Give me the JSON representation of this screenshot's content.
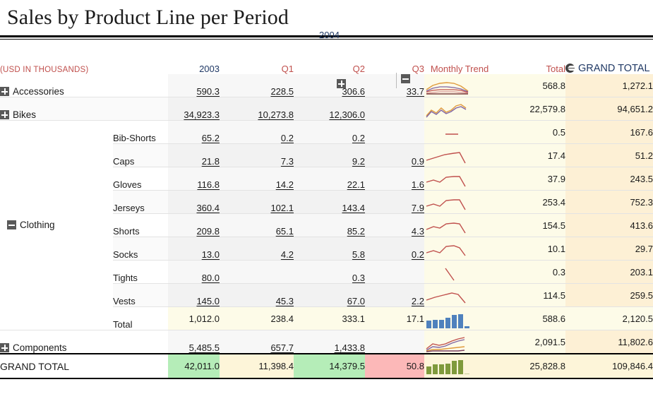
{
  "report": {
    "title": "Sales by Product Line per Period",
    "units_note": "(USD IN THOUSANDS)"
  },
  "header": {
    "year_2003": "2003",
    "year_2004": "2004",
    "q1": "Q1",
    "q2": "Q2",
    "q3": "Q3",
    "monthly_trend": "Monthly Trend",
    "total": "Total",
    "grand_total": "GRAND TOTAL",
    "toggle_2003": "expand-2003",
    "toggle_2004": "collapse-2004",
    "grand_total_icon": "sort-toggle-icon"
  },
  "columns": [
    "2003",
    "Q1",
    "Q2",
    "Q3",
    "Monthly Trend",
    "Total",
    "GRAND TOTAL"
  ],
  "rows": [
    {
      "label": "Accessories",
      "toggle": "plus",
      "level": "category",
      "y2003": "590.3",
      "q1": "228.5",
      "q2": "306.6",
      "q3": "33.7",
      "total": "568.8",
      "grand": "1,272.1",
      "spark": "multi-flat"
    },
    {
      "label": "Bikes",
      "toggle": "plus",
      "level": "category",
      "y2003": "34,923.3",
      "q1": "10,273.8",
      "q2": "12,306.0",
      "q3": "",
      "total": "22,579.8",
      "grand": "94,651.2",
      "spark": "multi-zigzag"
    },
    {
      "label": "Bib-Shorts",
      "level": "sub",
      "y2003": "65.2",
      "q1": "0.2",
      "q2": "0.2",
      "q3": "",
      "total": "0.5",
      "grand": "167.6",
      "spark": "stub"
    },
    {
      "label": "Caps",
      "level": "sub",
      "y2003": "21.8",
      "q1": "7.3",
      "q2": "9.2",
      "q3": "0.9",
      "total": "17.4",
      "grand": "51.2",
      "spark": "rise-drop"
    },
    {
      "label": "Gloves",
      "level": "sub",
      "y2003": "116.8",
      "q1": "14.2",
      "q2": "22.1",
      "q3": "1.6",
      "total": "37.9",
      "grand": "243.5",
      "spark": "wave-drop"
    },
    {
      "label": "Jerseys",
      "level": "sub",
      "y2003": "360.4",
      "q1": "102.1",
      "q2": "143.4",
      "q3": "7.9",
      "total": "253.4",
      "grand": "752.3",
      "spark": "wave-drop"
    },
    {
      "label": "Shorts",
      "level": "sub",
      "y2003": "209.8",
      "q1": "65.1",
      "q2": "85.2",
      "q3": "4.3",
      "total": "154.5",
      "grand": "413.6",
      "spark": "wave-drop"
    },
    {
      "label": "Socks",
      "level": "sub",
      "y2003": "13.0",
      "q1": "4.2",
      "q2": "5.8",
      "q3": "0.2",
      "total": "10.1",
      "grand": "29.7",
      "spark": "wave-drop"
    },
    {
      "label": "Tights",
      "level": "sub",
      "y2003": "80.0",
      "q1": "",
      "q2": "0.3",
      "q3": "",
      "total": "0.3",
      "grand": "203.1",
      "spark": "slash"
    },
    {
      "label": "Vests",
      "level": "sub",
      "y2003": "145.0",
      "q1": "45.3",
      "q2": "67.0",
      "q3": "2.2",
      "total": "114.5",
      "grand": "259.5",
      "spark": "rise-drop"
    },
    {
      "label": "Total",
      "level": "subtotal",
      "y2003": "1,012.0",
      "q1": "238.4",
      "q2": "333.1",
      "q3": "17.1",
      "total": "588.6",
      "grand": "2,120.5",
      "spark": "bars-blue"
    },
    {
      "label": "Components",
      "toggle": "plus",
      "level": "category",
      "y2003": "5,485.5",
      "q1": "657.7",
      "q2": "1,433.8",
      "q3": "",
      "total": "2,091.5",
      "grand": "11,802.6",
      "spark": "multi-rise"
    }
  ],
  "group_label": {
    "clothing": "Clothing",
    "clothing_toggle": "minus"
  },
  "grand_total_row": {
    "label": "GRAND TOTAL",
    "y2003": "42,011.0",
    "q1": "11,398.4",
    "q2": "14,379.5",
    "q3": "50.8",
    "total": "25,828.8",
    "grand": "109,846.4",
    "spark": "bars-green"
  },
  "colors": {
    "accent_red": "#c0504d",
    "header_blue": "#1f3864",
    "band_trend": "#fdfbe8",
    "band_grand": "#fdf0d5",
    "sparkline_red": "#c0504d",
    "bar_blue": "#4f81bd",
    "bar_green": "#7f9a3c",
    "cell_green": "#b5edb8",
    "cell_cream": "#fdf5d9",
    "cell_pink": "#fcb8b8"
  },
  "chart_data": {
    "type": "table",
    "title": "Sales by Product Line per Period",
    "units": "USD in thousands",
    "categories": [
      "Accessories",
      "Bikes",
      "Bib-Shorts",
      "Caps",
      "Gloves",
      "Jerseys",
      "Shorts",
      "Socks",
      "Tights",
      "Vests",
      "Clothing Total",
      "Components",
      "GRAND TOTAL"
    ],
    "series": [
      {
        "name": "2003",
        "values": [
          590.3,
          34923.3,
          65.2,
          21.8,
          116.8,
          360.4,
          209.8,
          13.0,
          80.0,
          145.0,
          1012.0,
          5485.5,
          42011.0
        ]
      },
      {
        "name": "Q1 2004",
        "values": [
          228.5,
          10273.8,
          0.2,
          7.3,
          14.2,
          102.1,
          65.1,
          4.2,
          null,
          45.3,
          238.4,
          657.7,
          11398.4
        ]
      },
      {
        "name": "Q2 2004",
        "values": [
          306.6,
          12306.0,
          0.2,
          9.2,
          22.1,
          143.4,
          85.2,
          5.8,
          0.3,
          67.0,
          333.1,
          1433.8,
          14379.5
        ]
      },
      {
        "name": "Q3 2004",
        "values": [
          33.7,
          null,
          null,
          0.9,
          1.6,
          7.9,
          4.3,
          0.2,
          null,
          2.2,
          17.1,
          null,
          50.8
        ]
      },
      {
        "name": "Total 2004",
        "values": [
          568.8,
          22579.8,
          0.5,
          17.4,
          37.9,
          253.4,
          154.5,
          10.1,
          0.3,
          114.5,
          588.6,
          2091.5,
          25828.8
        ]
      },
      {
        "name": "Grand Total",
        "values": [
          1272.1,
          94651.2,
          167.6,
          51.2,
          243.5,
          752.3,
          413.6,
          29.7,
          203.1,
          259.5,
          2120.5,
          11802.6,
          109846.4
        ]
      }
    ]
  }
}
